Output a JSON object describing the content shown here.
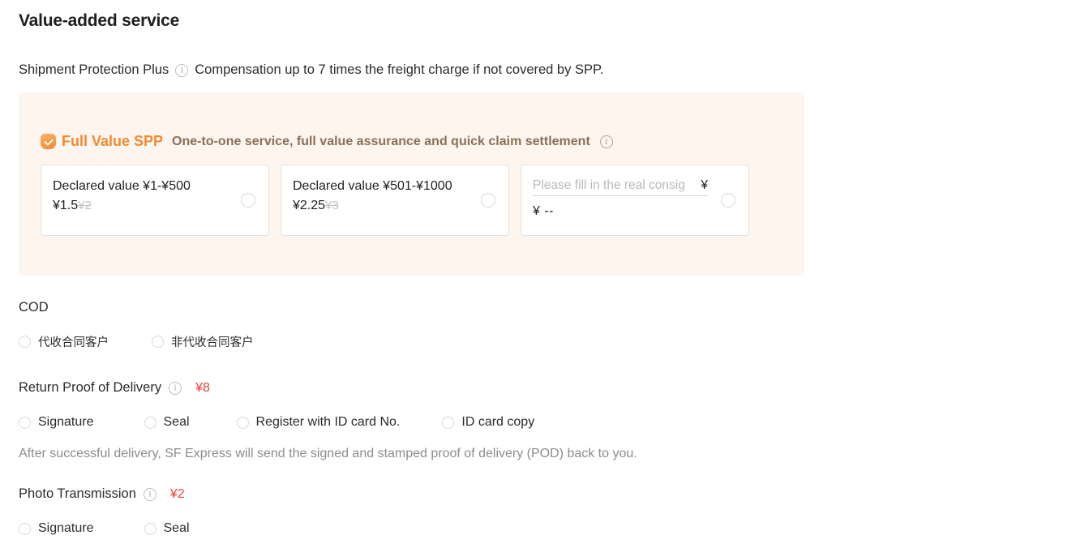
{
  "section": {
    "title": "Value-added service"
  },
  "spp": {
    "label": "Shipment Protection Plus",
    "info_icon": "info-icon",
    "description": "Compensation up to 7 times the freight charge if not covered by SPP.",
    "panel": {
      "badge_icon": "shield-check-icon",
      "title": "Full Value SPP",
      "subtitle": "One-to-one service, full value assurance and quick claim settlement",
      "info_icon": "info-icon",
      "background_color": "#FDF5EE",
      "title_color": "#EF8B32",
      "subtitle_color": "#8A6F58"
    },
    "options": [
      {
        "id": "spp-tier-1",
        "range_label": "Declared value ¥1-¥500",
        "price": "¥1.5",
        "price_original": "¥2",
        "selected": false
      },
      {
        "id": "spp-tier-2",
        "range_label": "Declared value ¥501-¥1000",
        "price": "¥2.25",
        "price_original": "¥3",
        "selected": false
      },
      {
        "id": "spp-tier-custom",
        "input_placeholder": "Please fill in the real consig",
        "input_value": "",
        "input_suffix": "¥",
        "price": "¥ --",
        "selected": false
      }
    ]
  },
  "cod": {
    "label": "COD",
    "options": [
      {
        "label": "代收合同客户",
        "selected": false
      },
      {
        "label": "非代收合同客户",
        "selected": false
      }
    ]
  },
  "pod": {
    "label": "Return Proof of Delivery",
    "info_icon": "info-icon",
    "price": "¥8",
    "price_color": "#E8413C",
    "options": [
      {
        "label": "Signature",
        "selected": false
      },
      {
        "label": "Seal",
        "selected": false
      },
      {
        "label": "Register with ID card No.",
        "selected": false
      },
      {
        "label": "ID card copy",
        "selected": false
      }
    ],
    "note": "After successful delivery, SF Express will send the signed and stamped proof of delivery (POD) back to you."
  },
  "photo": {
    "label": "Photo Transmission",
    "info_icon": "info-icon",
    "price": "¥2",
    "price_color": "#E8413C",
    "options": [
      {
        "label": "Signature",
        "selected": false
      },
      {
        "label": "Seal",
        "selected": false
      }
    ]
  }
}
